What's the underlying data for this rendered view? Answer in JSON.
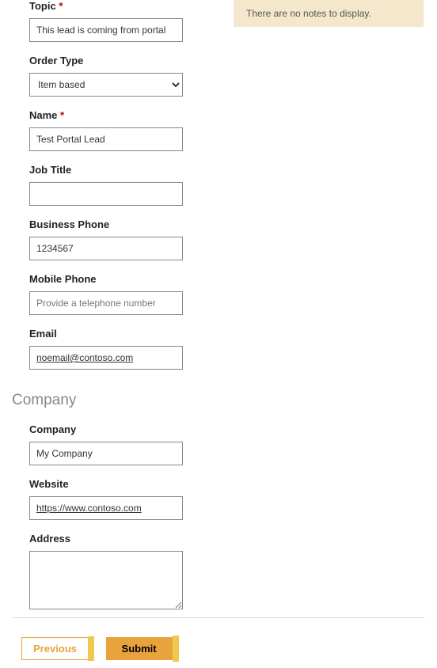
{
  "notes": {
    "empty_message": "There are no notes to display."
  },
  "fields": {
    "topic": {
      "label": "Topic",
      "required": true,
      "value": "This lead is coming from portal"
    },
    "order_type": {
      "label": "Order Type",
      "value": "Item based"
    },
    "name": {
      "label": "Name",
      "required": true,
      "value": "Test Portal Lead"
    },
    "job_title": {
      "label": "Job Title",
      "value": ""
    },
    "business_phone": {
      "label": "Business Phone",
      "value": "1234567"
    },
    "mobile_phone": {
      "label": "Mobile Phone",
      "placeholder": "Provide a telephone number",
      "value": ""
    },
    "email": {
      "label": "Email",
      "value": "noemail@contoso.com"
    }
  },
  "company_section": {
    "heading": "Company",
    "company": {
      "label": "Company",
      "value": "My Company"
    },
    "website": {
      "label": "Website",
      "value": "https://www.contoso.com"
    },
    "address": {
      "label": "Address",
      "value": ""
    }
  },
  "buttons": {
    "previous": "Previous",
    "submit": "Submit"
  },
  "required_marker": "*"
}
